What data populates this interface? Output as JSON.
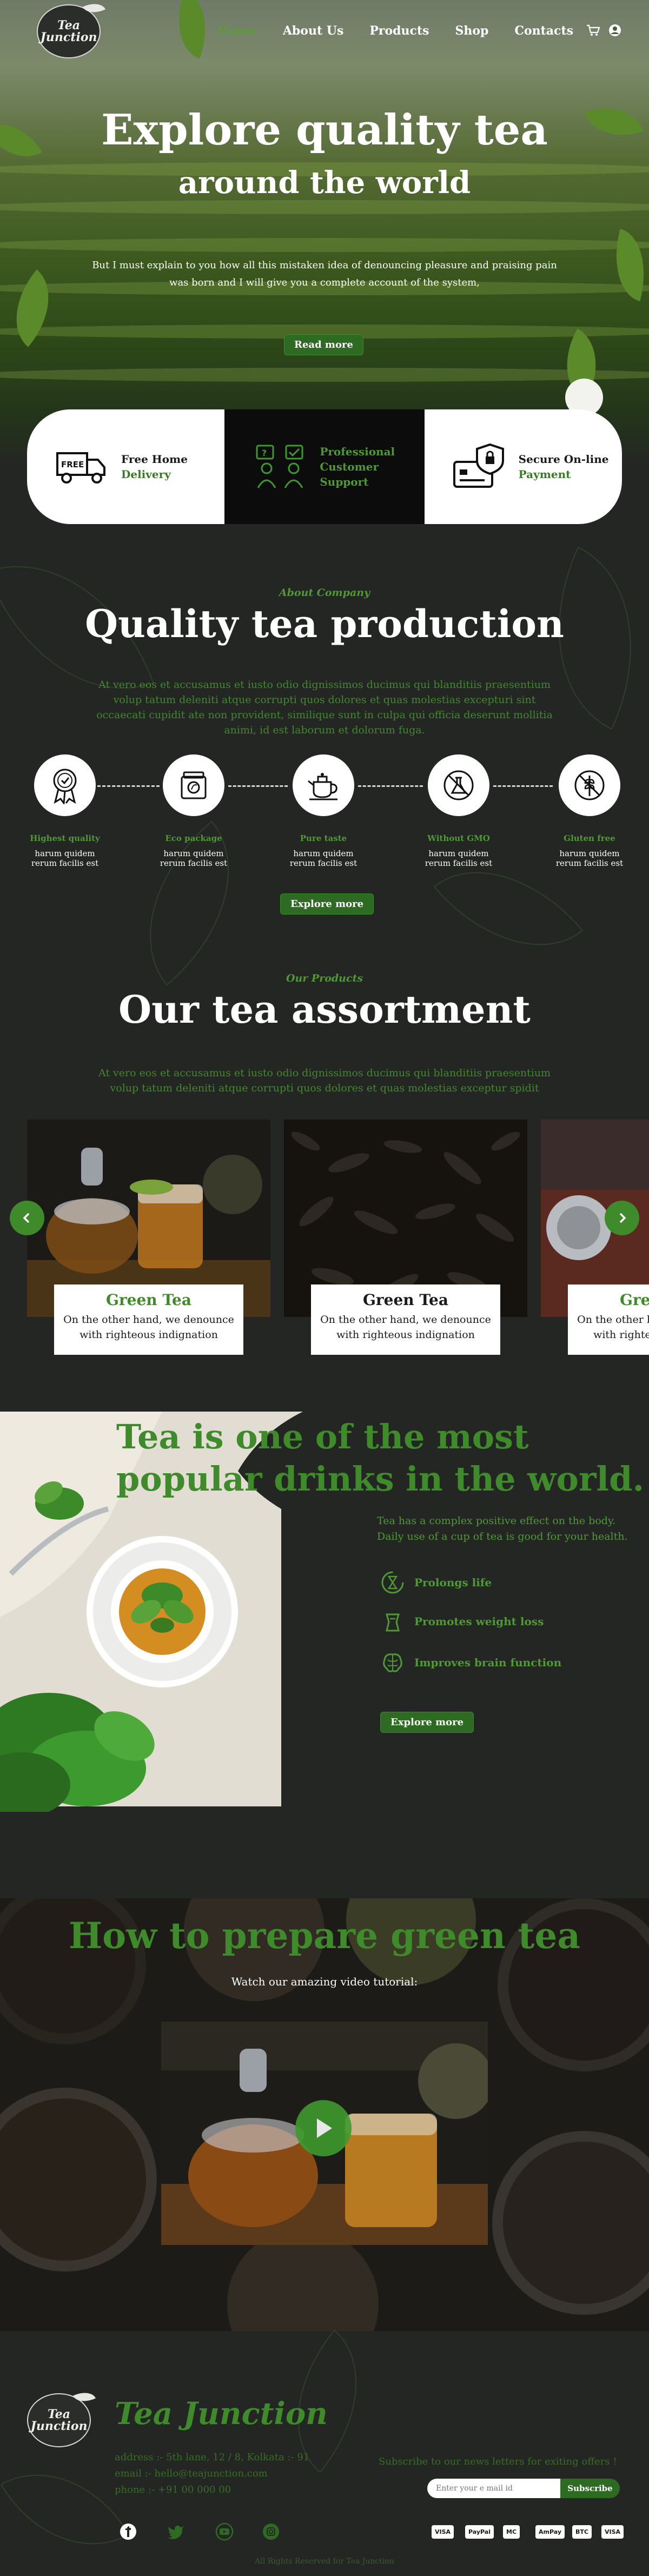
{
  "nav": {
    "logo_text": "Tea Junction",
    "links": [
      "Home",
      "About Us",
      "Products",
      "Shop",
      "Contacts"
    ],
    "cart_icon": "cart-icon",
    "user_icon": "user-icon"
  },
  "hero": {
    "title_line1": "Explore quality tea",
    "title_line2": "around the world",
    "text": "But I must explain to you how all this mistaken idea of denouncing pleasure and praising pain was born and I will give you a complete account of the system,",
    "button": "Read more"
  },
  "features": [
    {
      "line1": "Free Home",
      "line2": "Delivery",
      "icon": "delivery-truck-icon"
    },
    {
      "line1": "Professional",
      "line2": "Customer Support",
      "icon": "support-icon"
    },
    {
      "line1": "Secure On-line",
      "line2": "Payment",
      "icon": "secure-payment-icon"
    }
  ],
  "about": {
    "subtitle": "About Company",
    "title": "Quality tea production",
    "text": "At vero eos et accusamus et iusto odio dignissimos ducimus qui blanditiis praesentium volup tatum deleniti atque corrupti quos dolores et quas molestias excepturi sint occaecati cupidit ate non provident, similique sunt in culpa qui officia deserunt mollitia animi, id est laborum et dolorum fuga.",
    "steps": [
      {
        "title": "Highest quality",
        "text": "harum quidem rerum facilis est",
        "icon": "quality-badge-icon"
      },
      {
        "title": "Eco package",
        "text": "harum quidem rerum facilis est",
        "icon": "eco-package-icon"
      },
      {
        "title": "Pure taste",
        "text": "harum quidem rerum facilis est",
        "icon": "teapot-icon"
      },
      {
        "title": "Without GMO",
        "text": "harum quidem rerum facilis est",
        "icon": "no-gmo-icon"
      },
      {
        "title": "Gluten free",
        "text": "harum quidem rerum facilis est",
        "icon": "gluten-free-icon"
      }
    ],
    "button": "Explore more"
  },
  "products": {
    "subtitle": "Our Products",
    "title": "Our tea assortment",
    "text": "At vero eos et accusamus et iusto odio dignissimos ducimus qui blanditiis praesentium volup tatum deleniti atque corrupti quos dolores et quas molestias exceptur spidit",
    "items": [
      {
        "name": "Green Tea",
        "desc": "On the other hand, we denounce with righteous indignation"
      },
      {
        "name": "Green Tea",
        "desc": "On the other hand, we denounce with righteous indignation"
      },
      {
        "name": "Green Tea",
        "desc": "On the other hand, we denounce with righteous indignation"
      }
    ]
  },
  "popular": {
    "title": "Tea is one of the most popular drinks in the world.",
    "text": "Tea has a complex positive effect on the body. Daily use of a cup of tea is good for your health.",
    "benefits": [
      {
        "label": "Prolongs life",
        "icon": "hourglass-icon"
      },
      {
        "label": "Promotes weight loss",
        "icon": "weight-icon"
      },
      {
        "label": "Improves brain function",
        "icon": "brain-icon"
      }
    ],
    "button": "Explore more"
  },
  "video": {
    "title": "How to prepare green tea",
    "subtitle": "Watch our amazing video tutorial:"
  },
  "footer": {
    "brand": "Tea Junction",
    "address": "address :- 5th lane, 12 / 8, Kolkata :- 91",
    "email": "email :- hello@teajunction.com",
    "phone": "phone :- +91 00 000 00",
    "subscribe_text": "Subscribe to our news letters for exiting offers !",
    "input_placeholder": "Enter your e mail id",
    "subscribe_button": "Subscribe",
    "socials": [
      "facebook-icon",
      "twitter-icon",
      "youtube-icon",
      "instagram-icon"
    ],
    "payments": [
      "VISA",
      "PayPal",
      "MC",
      "AmPay",
      "BTC",
      "VISA"
    ],
    "copyright": "All Rights Reserved for Tea Junction"
  },
  "colors": {
    "accent_green": "#3f8a2a",
    "background": "#242624",
    "button_green": "#2e6b22"
  }
}
